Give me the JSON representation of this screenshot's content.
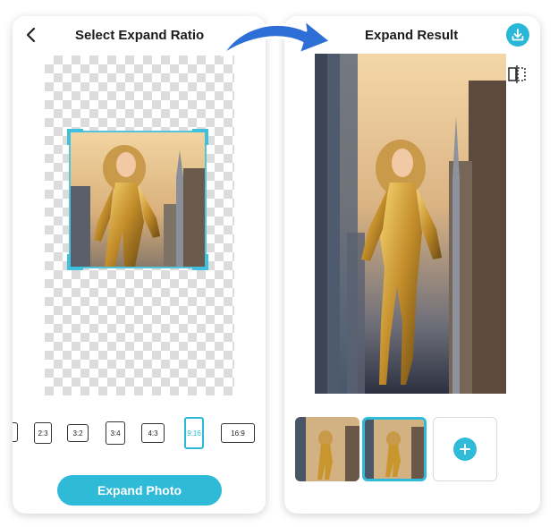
{
  "left": {
    "title": "Select Expand Ratio",
    "ratios": [
      {
        "label": ""
      },
      {
        "label": "2:3"
      },
      {
        "label": "3:2"
      },
      {
        "label": "3:4"
      },
      {
        "label": "4:3"
      },
      {
        "label": "9:16",
        "selected": true
      },
      {
        "label": "16:9"
      }
    ],
    "expand_button": "Expand Photo"
  },
  "right": {
    "title": "Expand Result"
  },
  "colors": {
    "accent": "#2fbad8",
    "arrow": "#2d6fd6"
  },
  "icons": {
    "back": "chevron-left-icon",
    "download": "download-icon",
    "compare": "compare-icon",
    "add": "plus-icon",
    "arrow": "curved-arrow-icon"
  }
}
